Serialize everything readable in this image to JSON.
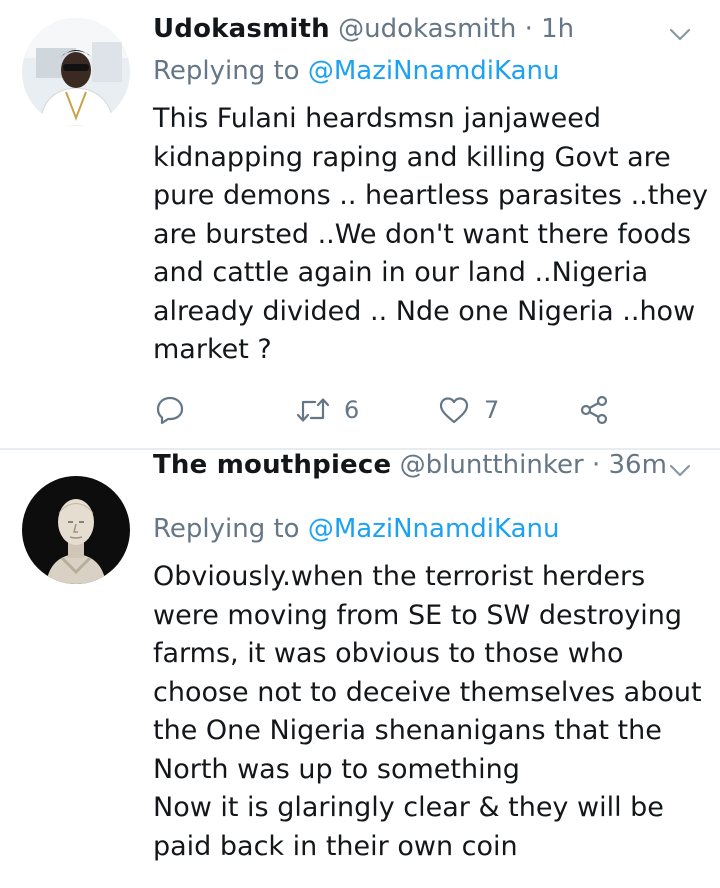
{
  "tweets": [
    {
      "name": "Udokasmith",
      "handle": "@udokasmith",
      "time": "1h",
      "replying_prefix": "Replying to",
      "replying_to": "@MaziNnamdiKanu",
      "text": "This Fulani heardsmsn janjaweed\nkidnapping raping and killing Govt are\npure demons .. heartless parasites ..they\nare bursted ..We don't want there foods\nand cattle again in our land ..Nigeria\nalready divided .. Nde one Nigeria ..how\nmarket ?",
      "actions": {
        "reply_icon": "reply-icon",
        "retweet_icon": "retweet-icon",
        "retweets": "6",
        "like_icon": "heart-icon",
        "likes": "7",
        "share_icon": "share-icon"
      },
      "menu_icon": "chevron-down-icon"
    },
    {
      "name": "The mouthpiece",
      "handle": "@bluntthinker",
      "time": "36m",
      "replying_prefix": "Replying to",
      "replying_to": "@MaziNnamdiKanu",
      "text": "Obviously.when the terrorist herders\nwere moving from SE to SW destroying\nfarms, it was obvious to those who\nchoose not to deceive themselves about\nthe One Nigeria shenanigans that the\nNorth was up to something\nNow it is glaringly clear & they will be\npaid back in their own coin",
      "menu_icon": "chevron-down-icon"
    }
  ],
  "colors": {
    "name": "#14171a",
    "meta": "#657786",
    "mention": "#1da1f2",
    "divider": "#e6ecf0"
  }
}
